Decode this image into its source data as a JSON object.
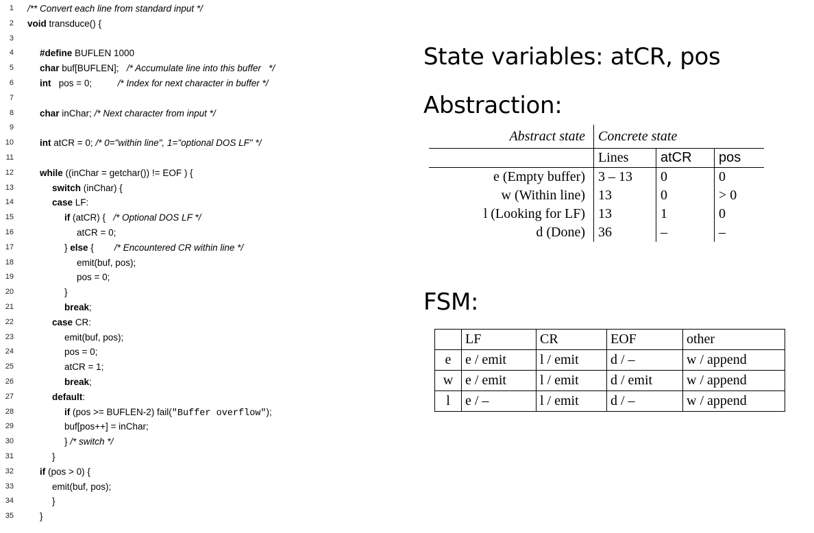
{
  "code": {
    "lines": [
      {
        "n": "1",
        "ind": 0,
        "parts": [
          [
            "cm",
            "/** Convert each line from standard input */"
          ]
        ]
      },
      {
        "n": "2",
        "ind": 0,
        "parts": [
          [
            "kw",
            "void"
          ],
          [
            "",
            " transduce() {"
          ]
        ]
      },
      {
        "n": "3",
        "ind": 0,
        "parts": []
      },
      {
        "n": "4",
        "ind": 1,
        "parts": [
          [
            "kw",
            "#define"
          ],
          [
            "",
            " BUFLEN 1000"
          ]
        ]
      },
      {
        "n": "5",
        "ind": 1,
        "parts": [
          [
            "kw",
            "char"
          ],
          [
            "",
            " buf[BUFLEN];   "
          ],
          [
            "cm",
            "/* Accumulate line into this buffer   */"
          ]
        ]
      },
      {
        "n": "6",
        "ind": 1,
        "parts": [
          [
            "kw",
            "int"
          ],
          [
            "",
            "   pos = 0;          "
          ],
          [
            "cm",
            "/* Index for next character in buffer */"
          ]
        ]
      },
      {
        "n": "7",
        "ind": 0,
        "parts": []
      },
      {
        "n": "8",
        "ind": 1,
        "parts": [
          [
            "kw",
            "char"
          ],
          [
            "",
            " inChar; "
          ],
          [
            "cm",
            "/* Next character from input */"
          ]
        ]
      },
      {
        "n": "9",
        "ind": 0,
        "parts": []
      },
      {
        "n": "10",
        "ind": 1,
        "parts": [
          [
            "kw",
            "int"
          ],
          [
            "",
            " atCR = 0; "
          ],
          [
            "cm",
            "/* 0=\"within line\", 1=\"optional DOS LF\" */"
          ]
        ]
      },
      {
        "n": "11",
        "ind": 0,
        "parts": []
      },
      {
        "n": "12",
        "ind": 1,
        "parts": [
          [
            "kw",
            "while"
          ],
          [
            "",
            " ((inChar = getchar()) != EOF ) {"
          ]
        ]
      },
      {
        "n": "13",
        "ind": 2,
        "parts": [
          [
            "kw",
            "switch"
          ],
          [
            "",
            " (inChar) {"
          ]
        ]
      },
      {
        "n": "14",
        "ind": 2,
        "parts": [
          [
            "kw",
            "case"
          ],
          [
            "",
            " LF:"
          ]
        ]
      },
      {
        "n": "15",
        "ind": 3,
        "parts": [
          [
            "kw",
            "if"
          ],
          [
            "",
            " (atCR) {   "
          ],
          [
            "cm",
            "/* Optional DOS LF */"
          ]
        ]
      },
      {
        "n": "16",
        "ind": 4,
        "parts": [
          [
            "",
            "atCR = 0;"
          ]
        ]
      },
      {
        "n": "17",
        "ind": 3,
        "parts": [
          [
            "",
            "} "
          ],
          [
            "kw",
            "else"
          ],
          [
            "",
            " {        "
          ],
          [
            "cm",
            "/* Encountered CR within line */"
          ]
        ]
      },
      {
        "n": "18",
        "ind": 4,
        "parts": [
          [
            "",
            "emit(buf, pos);"
          ]
        ]
      },
      {
        "n": "19",
        "ind": 4,
        "parts": [
          [
            "",
            "pos = 0;"
          ]
        ]
      },
      {
        "n": "20",
        "ind": 3,
        "parts": [
          [
            "",
            "}"
          ]
        ]
      },
      {
        "n": "21",
        "ind": 3,
        "parts": [
          [
            "kw",
            "break"
          ],
          [
            "",
            ";"
          ]
        ]
      },
      {
        "n": "22",
        "ind": 2,
        "parts": [
          [
            "kw",
            "case"
          ],
          [
            "",
            " CR:"
          ]
        ]
      },
      {
        "n": "23",
        "ind": 3,
        "parts": [
          [
            "",
            "emit(buf, pos);"
          ]
        ]
      },
      {
        "n": "24",
        "ind": 3,
        "parts": [
          [
            "",
            "pos = 0;"
          ]
        ]
      },
      {
        "n": "25",
        "ind": 3,
        "parts": [
          [
            "",
            "atCR = 1;"
          ]
        ]
      },
      {
        "n": "26",
        "ind": 3,
        "parts": [
          [
            "kw",
            "break"
          ],
          [
            "",
            ";"
          ]
        ]
      },
      {
        "n": "27",
        "ind": 2,
        "parts": [
          [
            "kw",
            "default"
          ],
          [
            "",
            ":"
          ]
        ]
      },
      {
        "n": "28",
        "ind": 3,
        "parts": [
          [
            "kw",
            "if"
          ],
          [
            "",
            " (pos >= BUFLEN-2) fail("
          ],
          [
            "mono",
            "\"Buffer overflow\""
          ],
          [
            "",
            ");"
          ]
        ]
      },
      {
        "n": "29",
        "ind": 3,
        "parts": [
          [
            "",
            "buf[pos++] = inChar;"
          ]
        ]
      },
      {
        "n": "30",
        "ind": 3,
        "parts": [
          [
            "",
            "} "
          ],
          [
            "cm",
            "/* switch */"
          ]
        ]
      },
      {
        "n": "31",
        "ind": 2,
        "parts": [
          [
            "",
            "}"
          ]
        ]
      },
      {
        "n": "32",
        "ind": 1,
        "parts": [
          [
            "kw",
            "if"
          ],
          [
            "",
            " (pos > 0) {"
          ]
        ]
      },
      {
        "n": "33",
        "ind": 2,
        "parts": [
          [
            "",
            "emit(buf, pos);"
          ]
        ]
      },
      {
        "n": "34",
        "ind": 2,
        "parts": [
          [
            "",
            "}"
          ]
        ]
      },
      {
        "n": "35",
        "ind": 1,
        "parts": [
          [
            "",
            "}"
          ]
        ]
      }
    ]
  },
  "headings": {
    "state_vars": "State variables: atCR, pos",
    "abstraction": "Abstraction:",
    "fsm": "FSM:"
  },
  "abstraction_table": {
    "header_abstract": "Abstract state",
    "header_concrete": "Concrete state",
    "subheaders": [
      "Lines",
      "atCR",
      "pos"
    ],
    "rows": [
      {
        "state": "e (Empty buffer)",
        "lines": "3 – 13",
        "atcr": "0",
        "pos": "0"
      },
      {
        "state": "w (Within line)",
        "lines": "13",
        "atcr": "0",
        "pos": "> 0"
      },
      {
        "state": "l (Looking for LF)",
        "lines": "13",
        "atcr": "1",
        "pos": "0"
      },
      {
        "state": "d (Done)",
        "lines": "36",
        "atcr": "–",
        "pos": "–"
      }
    ]
  },
  "fsm_table": {
    "headers": [
      "LF",
      "CR",
      "EOF",
      "other"
    ],
    "rows": [
      {
        "state": "e",
        "cells": [
          "e / emit",
          "l / emit",
          "d / –",
          "w / append"
        ]
      },
      {
        "state": "w",
        "cells": [
          "e / emit",
          "l / emit",
          "d / emit",
          "w / append"
        ]
      },
      {
        "state": "l",
        "cells": [
          "e / –",
          "l / emit",
          "d / –",
          "w / append"
        ]
      }
    ]
  }
}
